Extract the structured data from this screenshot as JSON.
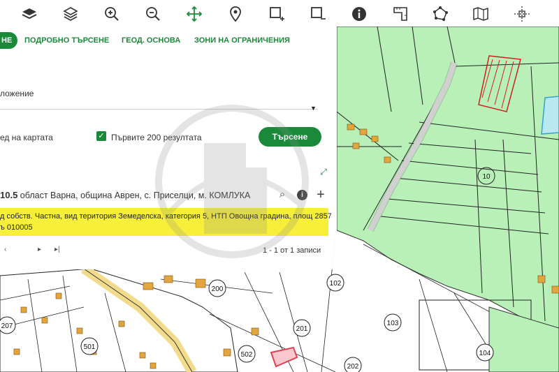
{
  "toolbar": {
    "icons": [
      "layers-icon",
      "layers-stack-icon",
      "zoom-in-icon",
      "zoom-out-icon",
      "pan-icon",
      "location-pin-icon",
      "add-selection-icon",
      "remove-selection-icon",
      "info-icon",
      "ruler-icon",
      "polygon-icon",
      "map-icon",
      "crosshair-icon"
    ]
  },
  "tabs": {
    "simple": "НЕ",
    "detailed": "ПОДРОБНО ТЪРСЕНЕ",
    "geobase": "ГЕОД. ОСНОВА",
    "restrictions": "ЗОНИ НА ОГРАНИЧЕНИЯ"
  },
  "form": {
    "location_label": "ложение",
    "map_view_label": "ед на картата",
    "first200_label": "Първите 200 резултата",
    "search_button": "Търсене"
  },
  "result": {
    "id_suffix": "10.5",
    "location": " област Варна, община Аврен, с. Приселци, м. КОМЛУКА",
    "line1": "д собств. Частна, вид територия Земеделска, категория 5, НТП Овощна градина, площ 2857",
    "line2": "ъ 010005"
  },
  "pager": {
    "count": "1 - 1 от 1 записи"
  },
  "map": {
    "labels": [
      "10",
      "102",
      "103",
      "104",
      "200",
      "201",
      "202",
      "207",
      "501",
      "502"
    ],
    "colors": {
      "farmland": "#b8f0b8",
      "road": "#f2dc8c",
      "building": "#e3a53d",
      "highlight": "#e04050",
      "accent": "#1a8a3a"
    }
  }
}
